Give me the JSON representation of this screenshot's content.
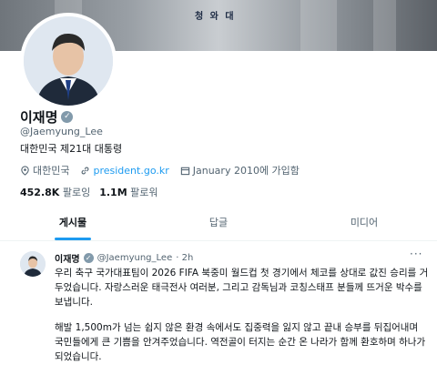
{
  "banner": {
    "caption": "청 와 대"
  },
  "profile": {
    "name": "이재명",
    "handle": "@Jaemyung_Lee",
    "bio": "대한민국 제21대 대통령",
    "location": "대한민국",
    "website": "president.go.kr",
    "joined": "January 2010에 가입함",
    "following_count": "452.8K",
    "following_label": "팔로잉",
    "followers_count": "1.1M",
    "followers_label": "팔로워"
  },
  "tabs": [
    "게시물",
    "답글",
    "미디어"
  ],
  "tweet": {
    "name": "이재명",
    "handle": "@Jaemyung_Lee",
    "time": "· 2h",
    "paragraph1": "우리 축구 국가대표팀이 2026 FIFA 북중미 월드컵 첫 경기에서 체코를 상대로 값진 승리를 거두었습니다. 자랑스러운 태극전사 여러분, 그리고 감독님과 코칭스태프 분들께 뜨거운 박수를 보냅니다.",
    "paragraph2": "해발 1,500m가 넘는 쉽지 않은 환경 속에서도 집중력을 잃지 않고 끝내 승부를 뒤집어내며 국민들에게 큰 기쁨을 안겨주었습니다. 역전골이 터지는 순간 온 나라가 함께 환호하며 하나가 되었습니다."
  },
  "icons": {
    "verified": "verified-badge-icon",
    "location": "location-pin-icon",
    "link": "link-icon",
    "calendar": "calendar-icon",
    "more": "more-icon"
  },
  "colors": {
    "accent": "#1d9bf0",
    "secondary_text": "#536471",
    "verified_badge": "#829aab"
  }
}
